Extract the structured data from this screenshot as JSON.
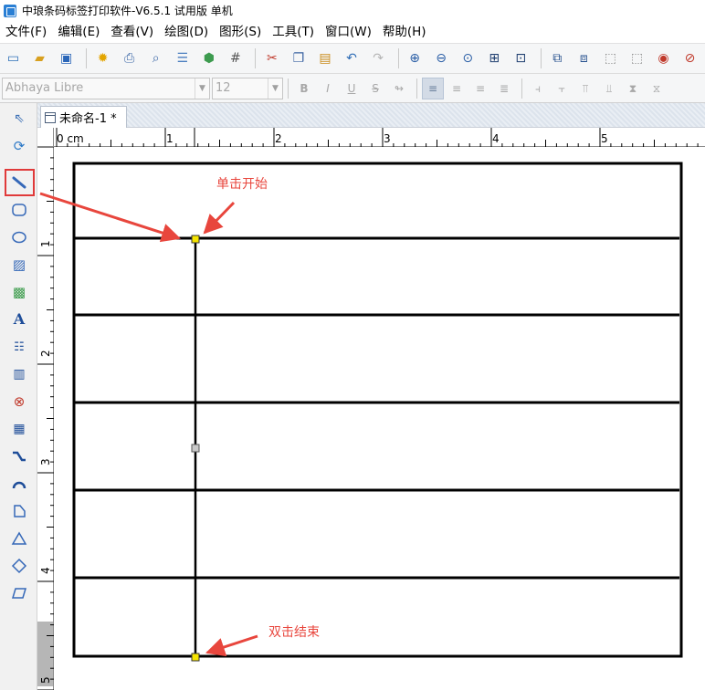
{
  "window": {
    "title": "中琅条码标签打印软件-V6.5.1 试用版 单机"
  },
  "menu": [
    "文件(F)",
    "编辑(E)",
    "查看(V)",
    "绘图(D)",
    "图形(S)",
    "工具(T)",
    "窗口(W)",
    "帮助(H)"
  ],
  "format_bar": {
    "font_name": "Abhaya Libre",
    "font_size": "12"
  },
  "document_tab": {
    "label": "未命名-1 *"
  },
  "ruler": {
    "unit": "cm",
    "top_labels": [
      "0 cm",
      "1",
      "2",
      "3",
      "4",
      "5"
    ],
    "left_labels": [
      "1",
      "2",
      "3",
      "4",
      "5"
    ]
  },
  "annotations": {
    "start": "单击开始",
    "end": "双击结束"
  },
  "colors": {
    "annotation": "#e8463d",
    "highlight": "#e03a3a",
    "handle_end": "#f5e400",
    "handle_mid": "#c8c8c8"
  },
  "toolbar_icons": [
    "new-icon",
    "open-icon",
    "save-icon",
    "settings-icon",
    "print-icon",
    "print-preview-icon",
    "database-icon",
    "data-source-icon",
    "grid-icon",
    "cut-icon",
    "copy-icon",
    "paste-icon",
    "undo-icon",
    "redo-icon",
    "zoom-in-icon",
    "zoom-out-icon",
    "zoom-fit-icon",
    "actual-size-icon",
    "page-fit-icon",
    "bring-front-icon",
    "send-back-icon",
    "group-icon",
    "ungroup-icon",
    "lock-icon",
    "cancel-icon"
  ],
  "drawing_tools": [
    "select-tool",
    "rotate-tool",
    "line-tool",
    "rounded-rect-tool",
    "ellipse-tool",
    "image-tool",
    "picture-tool",
    "text-tool",
    "rich-text-tool",
    "barcode-tool",
    "qrcode-tool",
    "matrix-code-tool",
    "curve-tool",
    "arc-tool",
    "polygon-tool",
    "triangle-tool",
    "diamond-tool",
    "parallelogram-tool"
  ]
}
